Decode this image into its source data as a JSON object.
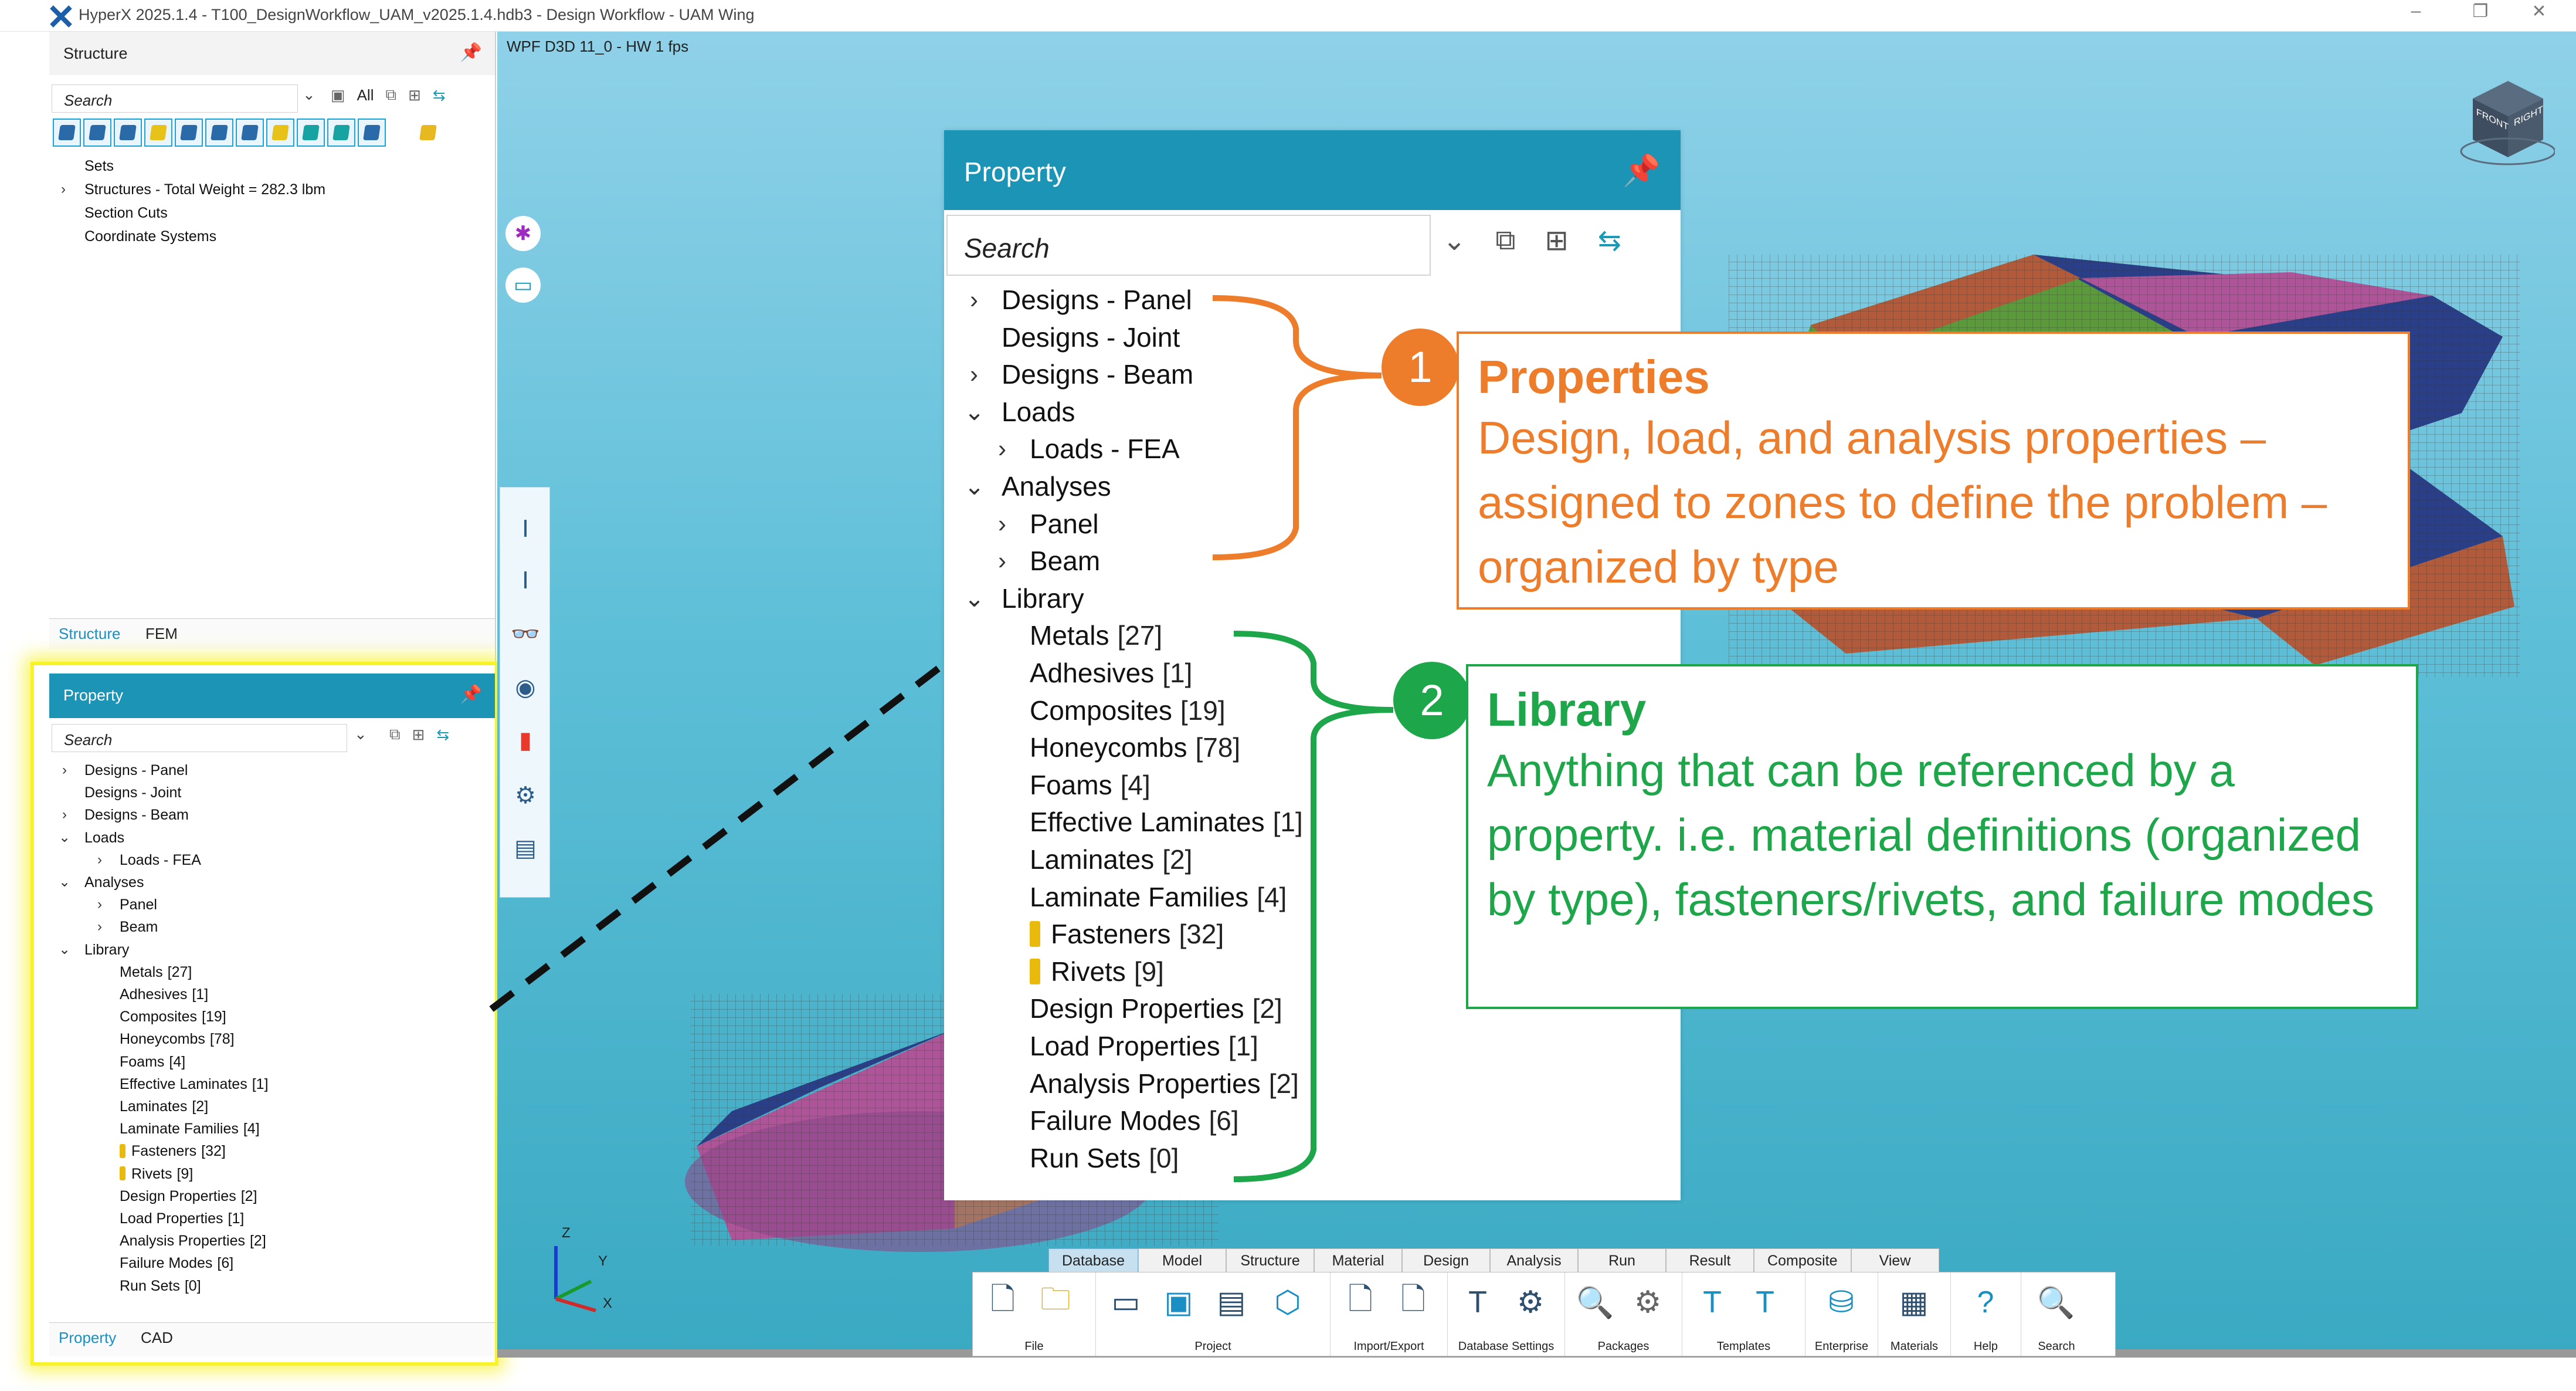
{
  "window": {
    "title": "HyperX 2025.1.4 - T100_DesignWorkflow_UAM_v2025.1.4.hdb3 - Design Workflow - UAM Wing",
    "controls": {
      "minimize": "–",
      "restore": "❐",
      "close": "✕"
    }
  },
  "structure_panel": {
    "title": "Structure",
    "search_placeholder": "Search",
    "filter_label": "All",
    "tree": [
      {
        "label": "Sets",
        "expandable": false
      },
      {
        "label": "Structures - Total Weight = 282.3 lbm",
        "expandable": true
      },
      {
        "label": "Section Cuts",
        "expandable": false
      },
      {
        "label": "Coordinate Systems",
        "expandable": false
      }
    ],
    "tabs": [
      "Structure",
      "FEM"
    ]
  },
  "property_panel": {
    "title": "Property",
    "search_placeholder": "Search",
    "tree": [
      {
        "label": "Designs - Panel",
        "indent": 0,
        "arrow": "right"
      },
      {
        "label": "Designs - Joint",
        "indent": 0,
        "arrow": ""
      },
      {
        "label": "Designs - Beam",
        "indent": 0,
        "arrow": "right"
      },
      {
        "label": "Loads",
        "indent": 0,
        "arrow": "down"
      },
      {
        "label": "Loads - FEA",
        "indent": 1,
        "arrow": "right"
      },
      {
        "label": "Analyses",
        "indent": 0,
        "arrow": "down"
      },
      {
        "label": "Panel",
        "indent": 1,
        "arrow": "right"
      },
      {
        "label": "Beam",
        "indent": 1,
        "arrow": "right"
      },
      {
        "label": "Library",
        "indent": 0,
        "arrow": "down"
      },
      {
        "label": "Metals",
        "count": "[27]",
        "indent": 1,
        "arrow": ""
      },
      {
        "label": "Adhesives",
        "count": "[1]",
        "indent": 1,
        "arrow": ""
      },
      {
        "label": "Composites",
        "count": "[19]",
        "indent": 1,
        "arrow": ""
      },
      {
        "label": "Honeycombs",
        "count": "[78]",
        "indent": 1,
        "arrow": ""
      },
      {
        "label": "Foams",
        "count": "[4]",
        "indent": 1,
        "arrow": ""
      },
      {
        "label": "Effective Laminates",
        "count": "[1]",
        "indent": 1,
        "arrow": ""
      },
      {
        "label": "Laminates",
        "count": "[2]",
        "indent": 1,
        "arrow": ""
      },
      {
        "label": "Laminate Families",
        "count": "[4]",
        "indent": 1,
        "arrow": ""
      },
      {
        "label": "Fasteners",
        "count": "[32]",
        "indent": 1,
        "arrow": "",
        "icon": "fastener-icon"
      },
      {
        "label": "Rivets",
        "count": "[9]",
        "indent": 1,
        "arrow": "",
        "icon": "rivet-icon"
      },
      {
        "label": "Design Properties",
        "count": "[2]",
        "indent": 1,
        "arrow": ""
      },
      {
        "label": "Load Properties",
        "count": "[1]",
        "indent": 1,
        "arrow": ""
      },
      {
        "label": "Analysis Properties",
        "count": "[2]",
        "indent": 1,
        "arrow": ""
      },
      {
        "label": "Failure Modes",
        "count": "[6]",
        "indent": 1,
        "arrow": ""
      },
      {
        "label": "Run Sets",
        "count": "[0]",
        "indent": 1,
        "arrow": ""
      }
    ],
    "tabs": [
      "Property",
      "CAD"
    ]
  },
  "viewport": {
    "label": "WPF D3D 11_0 - HW 1 fps",
    "nav_cube": {
      "front": "FRONT",
      "right": "RIGHT"
    },
    "axes": {
      "z": "Z",
      "y": "Y",
      "x": "X"
    }
  },
  "ribbon": {
    "tabs": [
      "Database",
      "Model",
      "Structure",
      "Material",
      "Design",
      "Analysis",
      "Run",
      "Result",
      "Composite",
      "View"
    ],
    "active_tab": "Database",
    "groups": [
      "File",
      "Project",
      "Import/Export",
      "Database Settings",
      "Packages",
      "Templates",
      "Enterprise",
      "Materials",
      "Help",
      "Search"
    ]
  },
  "annotations": {
    "properties": {
      "number": "1",
      "title": "Properties",
      "body": "Design, load, and analysis properties – assigned to zones to define the problem – organized by type",
      "color": "#ee7d2b"
    },
    "library": {
      "number": "2",
      "title": "Library",
      "body": "Anything that can be referenced by a property. i.e. material definitions (organized by type), fasteners/rivets, and failure modes",
      "color": "#1ea64a"
    }
  },
  "colors": {
    "accent": "#1c94b5",
    "highlight": "#f7f22a",
    "fastener": "#e9b90c"
  }
}
